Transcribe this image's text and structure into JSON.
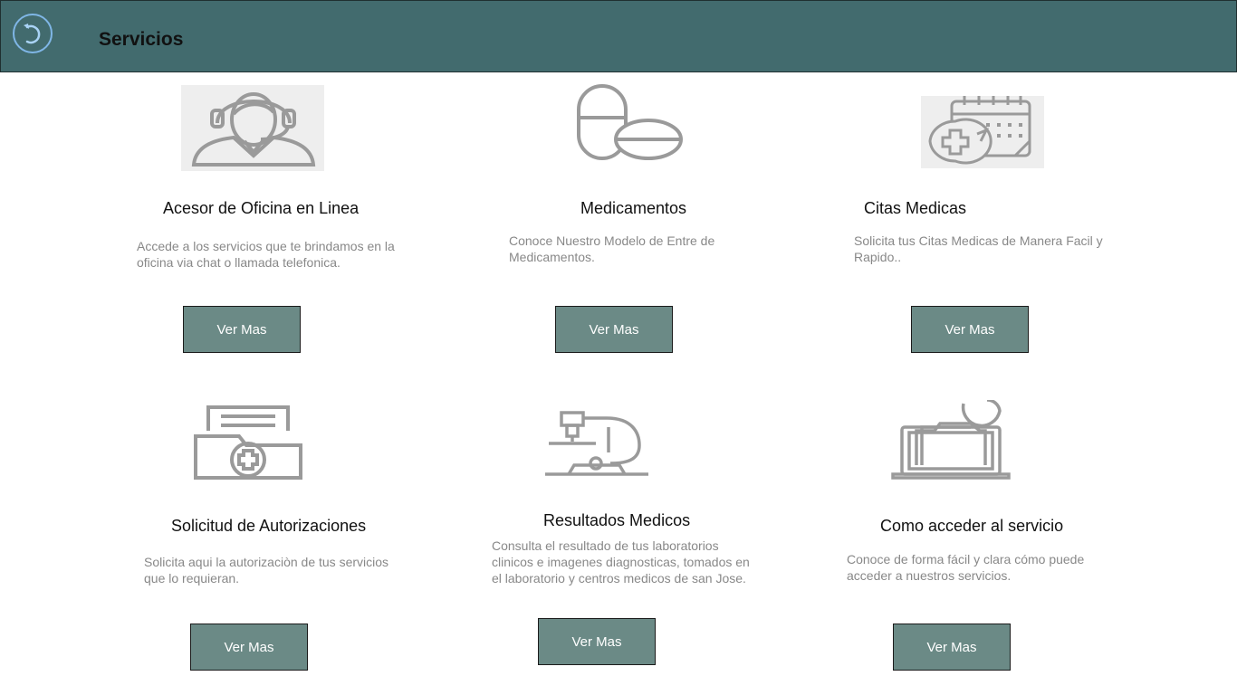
{
  "header": {
    "title": "Servicios",
    "back_icon": "back-arrow-icon"
  },
  "colors": {
    "header_bg": "#426b6e",
    "button_bg": "#6b8a86",
    "icon_gray": "#9a9a9a"
  },
  "cards": [
    {
      "title": "Acesor de Oficina en Linea",
      "description": "Accede a los servicios que te brindamos en la oficina via chat o llamada telefonica.",
      "button_label": "Ver Mas",
      "icon": "support-agent-icon"
    },
    {
      "title": "Medicamentos",
      "description": "Conoce Nuestro Modelo  de Entre de Medicamentos.",
      "button_label": "Ver Mas",
      "icon": "pills-icon"
    },
    {
      "title": "Citas Medicas",
      "description": "Solicita tus Citas Medicas de Manera Facil y Rapido..",
      "button_label": "Ver Mas",
      "icon": "medical-calendar-icon"
    },
    {
      "title": "Solicitud de Autorizaciones",
      "description": "Solicita aqui la autorizaciòn  de tus servicios que lo requieran.",
      "button_label": "Ver Mas",
      "icon": "medical-folder-icon"
    },
    {
      "title": "Resultados Medicos",
      "description": "Consulta el resultado de tus laboratorios clinicos e imagenes diagnosticas, tomados en el laboratorio y centros medicos de san Jose.",
      "button_label": "Ver Mas",
      "icon": "microscope-icon"
    },
    {
      "title": "Como acceder al servicio",
      "description": "Conoce de forma fácil y clara cómo puede acceder a nuestros servicios.",
      "button_label": "Ver Mas",
      "icon": "laptop-folder-icon"
    }
  ]
}
